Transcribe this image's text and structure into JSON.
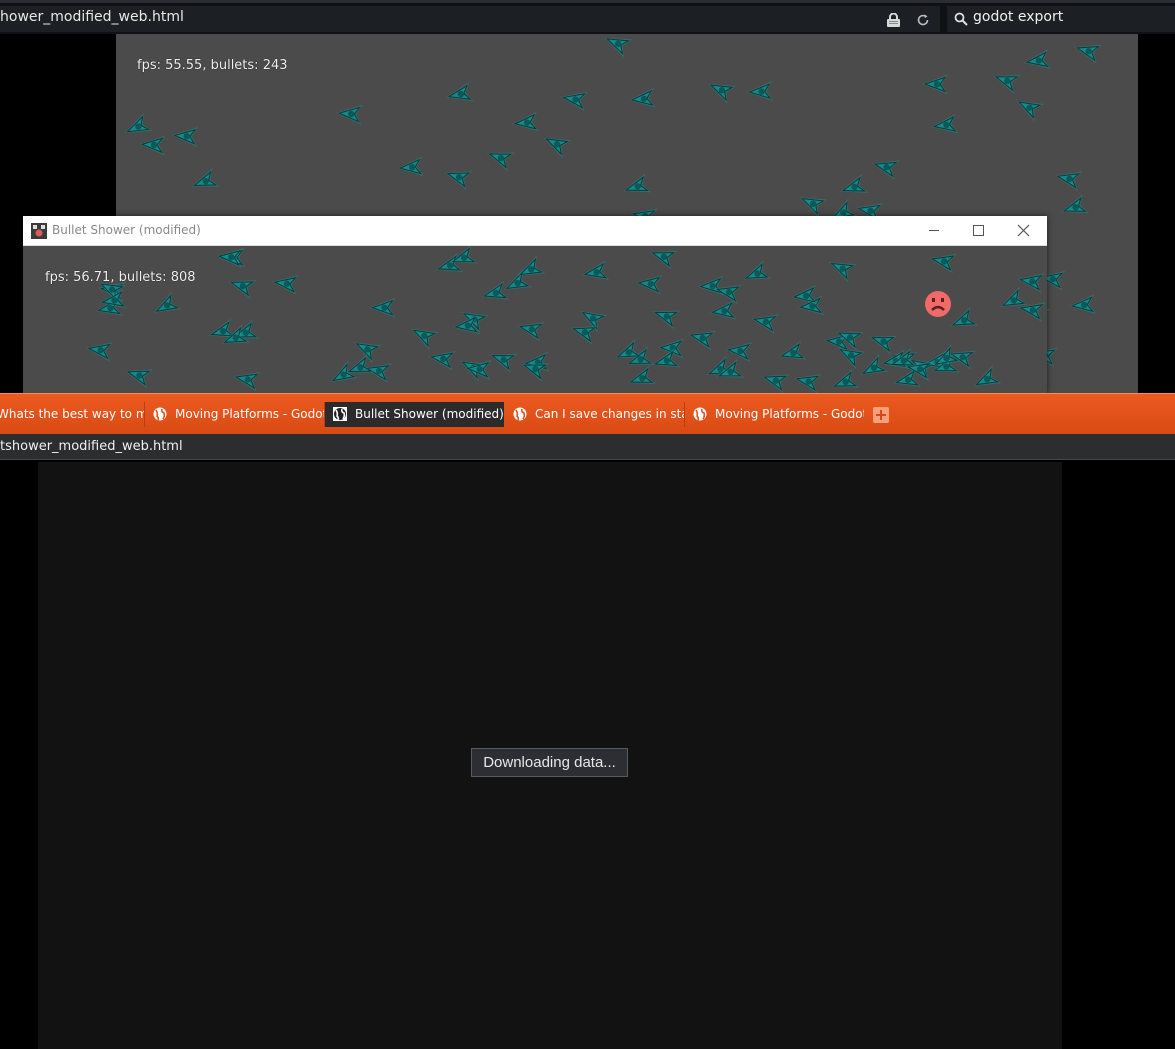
{
  "browser": {
    "url": "hower_modified_web.html",
    "search_query": "godot export"
  },
  "game_back": {
    "fps_text": "fps: 55.55, bullets: 243"
  },
  "game_window": {
    "title": "Bullet Shower (modified)",
    "fps_text": "fps: 56.71, bullets: 808"
  },
  "tabs": [
    {
      "label": "Whats the best way to make",
      "active": false
    },
    {
      "label": "Moving Platforms - Godot Eng",
      "active": false
    },
    {
      "label": "Bullet Shower (modified)",
      "active": true
    },
    {
      "label": "Can I save changes in static b",
      "active": false
    },
    {
      "label": "Moving Platforms - Godot Eng",
      "active": false
    }
  ],
  "address_bar_2": {
    "url": "tshower_modified_web.html"
  },
  "loading": {
    "status": "Downloading data..."
  },
  "colors": {
    "tab_strip": "#e4521a",
    "canvas_bg": "#4b4b4b",
    "bullet": "#1aa3a3",
    "player_face": "#f06a6a"
  },
  "icons": [
    "lock-icon",
    "reload-icon",
    "search-icon",
    "globe-icon",
    "minimize-icon",
    "maximize-icon",
    "close-icon",
    "new-tab-icon",
    "sad-face-icon"
  ]
}
